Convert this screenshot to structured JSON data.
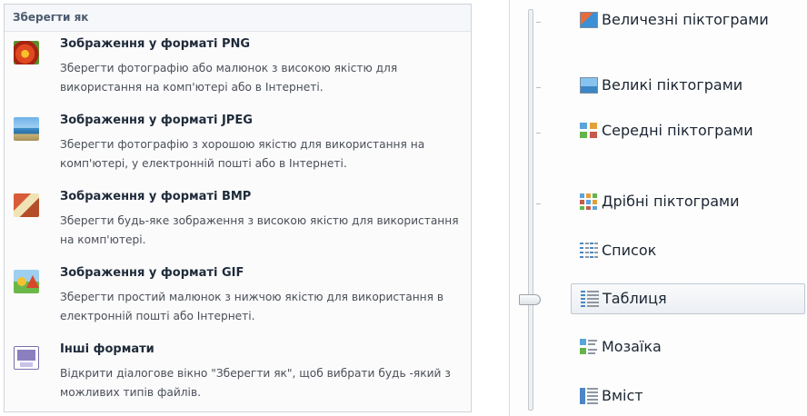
{
  "save_as": {
    "header": "Зберегти як",
    "items": [
      {
        "title": "Зображення у форматі PNG",
        "description": "Зберегти фотографію або малюнок з високою якістю для використання на комп'ютері або в Інтернеті.",
        "icon": "png-image-icon"
      },
      {
        "title": "Зображення у форматі JPEG",
        "description": "Зберегти фотографію з хорошою якістю для використання на комп'ютері, у електронній пошті або в Інтернеті.",
        "icon": "jpeg-image-icon"
      },
      {
        "title": "Зображення у форматі BMP",
        "description": "Зберегти будь-яке зображення з високою якістю для використання на комп'ютері.",
        "icon": "bmp-image-icon"
      },
      {
        "title": "Зображення у форматі GIF",
        "description": "Зберегти простий малюнок з нижчою якістю для використання в електронній пошті або Інтернеті.",
        "icon": "gif-image-icon"
      },
      {
        "title": "Інші формати",
        "description": "Відкрити діалогове вікно \"Зберегти як\", щоб вибрати будь -який з можливих типів файлів.",
        "icon": "other-formats-icon"
      }
    ]
  },
  "view_menu": {
    "items": [
      {
        "label": "Величезні піктограми",
        "icon": "extra-large-icons-icon"
      },
      {
        "label": "Великі піктограми",
        "icon": "large-icons-icon"
      },
      {
        "label": "Середні піктограми",
        "icon": "medium-icons-icon"
      },
      {
        "label": "Дрібні піктограми",
        "icon": "small-icons-icon"
      },
      {
        "label": "Список",
        "icon": "list-view-icon"
      },
      {
        "label": "Таблиця",
        "icon": "details-view-icon"
      },
      {
        "label": "Мозаїка",
        "icon": "tiles-view-icon"
      },
      {
        "label": "Вміст",
        "icon": "content-view-icon"
      }
    ],
    "selected": "Таблиця"
  }
}
